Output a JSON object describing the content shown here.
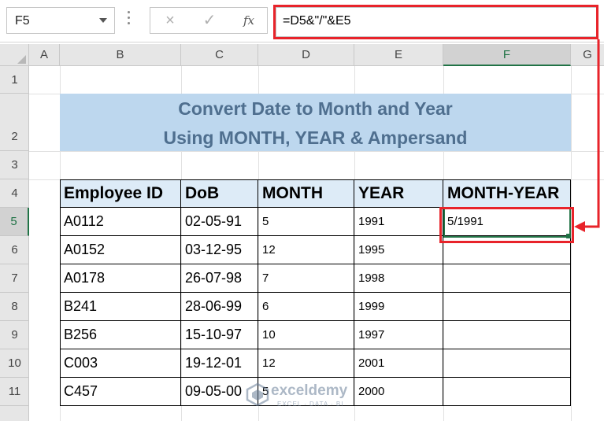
{
  "formula_bar": {
    "name_box": "F5",
    "cancel_icon": "×",
    "enter_icon": "✓",
    "fx_label": "fx",
    "formula": "=D5&\"/\"&E5"
  },
  "columns": [
    "A",
    "B",
    "C",
    "D",
    "E",
    "F",
    "G"
  ],
  "rows": [
    "1",
    "2",
    "3",
    "4",
    "5",
    "6",
    "7",
    "8",
    "9",
    "10",
    "11"
  ],
  "selected": {
    "column": "F",
    "row": "5",
    "cell": "F5"
  },
  "title": {
    "line1": "Convert Date to Month and Year",
    "line2": "Using MONTH, YEAR & Ampersand"
  },
  "table": {
    "headers": [
      "Employee ID",
      "DoB",
      "MONTH",
      "YEAR",
      "MONTH-YEAR"
    ],
    "rows": [
      [
        "A0112",
        "02-05-91",
        "5",
        "1991",
        "5/1991"
      ],
      [
        "A0152",
        "03-12-95",
        "12",
        "1995",
        ""
      ],
      [
        "A0178",
        "26-07-98",
        "7",
        "1998",
        ""
      ],
      [
        "B241",
        "28-06-99",
        "6",
        "1999",
        ""
      ],
      [
        "B256",
        "15-10-97",
        "10",
        "1997",
        ""
      ],
      [
        "C003",
        "19-12-01",
        "12",
        "2001",
        ""
      ],
      [
        "C457",
        "09-05-00",
        "5",
        "2000",
        ""
      ]
    ]
  },
  "watermark": {
    "name": "exceldemy",
    "tagline": "EXCEL · DATA · BI"
  },
  "colors": {
    "accent": "#217346",
    "highlight": "#e8232a",
    "banner": "#bdd7ee",
    "header_fill": "#ddebf7"
  }
}
